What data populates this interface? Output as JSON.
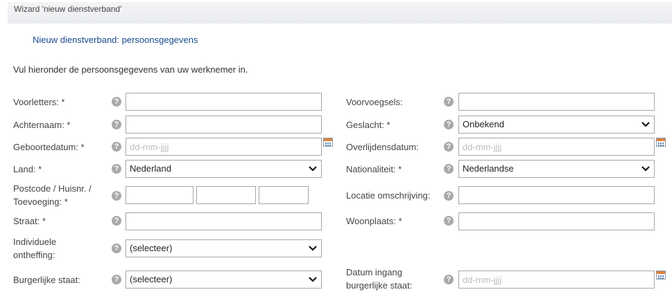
{
  "wizard": {
    "title": "Wizard 'nieuw dienstverband'"
  },
  "step_title": "Nieuw dienstverband: persoonsgegevens",
  "intro": "Vul hieronder de persoonsgegevens van uw werknemer in.",
  "help_glyph": "?",
  "left": {
    "voorletters": {
      "label": "Voorletters: *",
      "value": ""
    },
    "achternaam": {
      "label": "Achternaam: *",
      "value": ""
    },
    "geboortedatum": {
      "label": "Geboortedatum: *",
      "placeholder": "dd-mm-jjjj"
    },
    "land": {
      "label": "Land: *",
      "selected": "Nederland"
    },
    "postcode": {
      "label_line1": "Postcode / Huisnr. /",
      "label_line2": "Toevoeging: *"
    },
    "straat": {
      "label": "Straat: *",
      "value": ""
    },
    "ontheffing": {
      "label_line1": "Individuele",
      "label_line2": "ontheffing:",
      "selected": "(selecteer)"
    },
    "burgerlijke_staat": {
      "label": "Burgerlijke staat:",
      "selected": "(selecteer)"
    }
  },
  "right": {
    "voorvoegsels": {
      "label": "Voorvoegsels:",
      "value": ""
    },
    "geslacht": {
      "label": "Geslacht: *",
      "selected": "Onbekend"
    },
    "overlijdensdatum": {
      "label": "Overlijdensdatum:",
      "placeholder": "dd-mm-jjjj"
    },
    "nationaliteit": {
      "label": "Nationaliteit: *",
      "selected": "Nederlandse"
    },
    "locatie": {
      "label": "Locatie omschrijving:",
      "value": ""
    },
    "woonplaats": {
      "label": "Woonplaats: *",
      "value": ""
    },
    "datum_ingang": {
      "label_line1": "Datum ingang",
      "label_line2": "burgerlijke staat:",
      "placeholder": "dd-mm-jjjj"
    }
  }
}
